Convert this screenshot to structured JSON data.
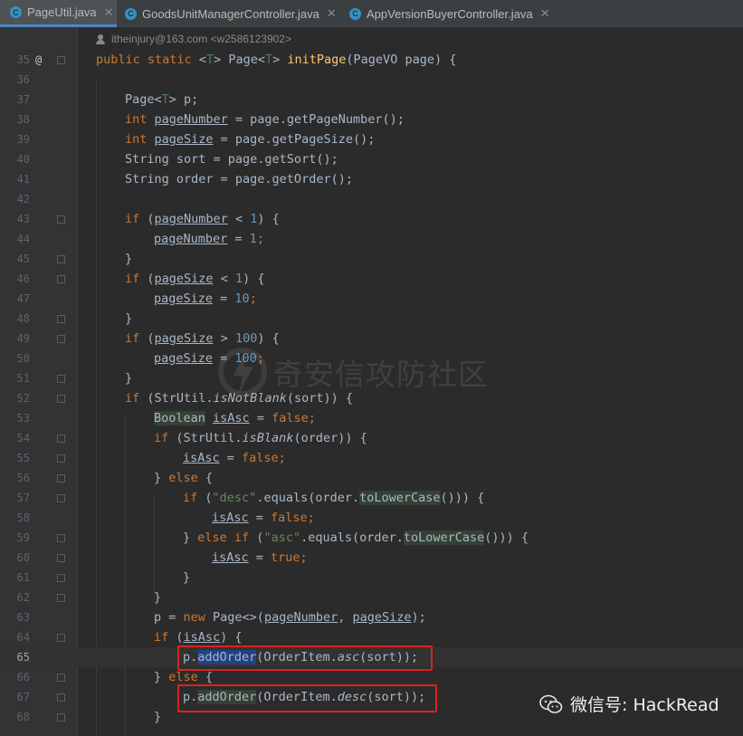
{
  "tabs": [
    {
      "label": "PageUtil.java",
      "active": true
    },
    {
      "label": "GoodsUnitManagerController.java",
      "active": false
    },
    {
      "label": "AppVersionBuyerController.java",
      "active": false
    }
  ],
  "author_hint": "itheinjury@163.com <w2586123902>",
  "line_numbers": [
    "35",
    "36",
    "37",
    "38",
    "39",
    "40",
    "41",
    "42",
    "43",
    "44",
    "45",
    "46",
    "47",
    "48",
    "49",
    "50",
    "51",
    "52",
    "53",
    "54",
    "55",
    "56",
    "57",
    "58",
    "59",
    "60",
    "61",
    "62",
    "63",
    "64",
    "65",
    "66",
    "67",
    "68"
  ],
  "code_lines": [
    [
      {
        "t": "public static ",
        "c": "kw"
      },
      {
        "t": "<"
      },
      {
        "t": "T",
        "c": "tp"
      },
      {
        "t": "> Page<"
      },
      {
        "t": "T",
        "c": "tp"
      },
      {
        "t": "> "
      },
      {
        "t": "initPage",
        "c": "fn"
      },
      {
        "t": "(PageVO page) {"
      }
    ],
    [],
    [
      {
        "t": "Page<"
      },
      {
        "t": "T",
        "c": "tp"
      },
      {
        "t": "> p;"
      }
    ],
    [
      {
        "t": "int ",
        "c": "kw"
      },
      {
        "t": "pageNumber",
        "c": "ul"
      },
      {
        "t": " = page.getPageNumber();"
      }
    ],
    [
      {
        "t": "int ",
        "c": "kw"
      },
      {
        "t": "pageSize",
        "c": "ul"
      },
      {
        "t": " = page.getPageSize();"
      }
    ],
    [
      {
        "t": "String sort = page.getSort();"
      }
    ],
    [
      {
        "t": "String order = page.getOrder();"
      }
    ],
    [],
    [
      {
        "t": "if ",
        "c": "kw"
      },
      {
        "t": "("
      },
      {
        "t": "pageNumber",
        "c": "ul"
      },
      {
        "t": " < "
      },
      {
        "t": "1",
        "c": "nm"
      },
      {
        "t": ") {"
      }
    ],
    [
      {
        "t": "pageNumber",
        "c": "ul"
      },
      {
        "t": " = "
      },
      {
        "t": "1",
        "c": "nm"
      },
      {
        "t": ";",
        "c": "kw"
      }
    ],
    [
      {
        "t": "}"
      }
    ],
    [
      {
        "t": "if ",
        "c": "kw"
      },
      {
        "t": "("
      },
      {
        "t": "pageSize",
        "c": "ul"
      },
      {
        "t": " < "
      },
      {
        "t": "1",
        "c": "nm"
      },
      {
        "t": ") {"
      }
    ],
    [
      {
        "t": "pageSize",
        "c": "ul"
      },
      {
        "t": " = "
      },
      {
        "t": "10",
        "c": "nm"
      },
      {
        "t": ";",
        "c": "kw"
      }
    ],
    [
      {
        "t": "}"
      }
    ],
    [
      {
        "t": "if ",
        "c": "kw"
      },
      {
        "t": "("
      },
      {
        "t": "pageSize",
        "c": "ul"
      },
      {
        "t": " > "
      },
      {
        "t": "100",
        "c": "nm"
      },
      {
        "t": ") {"
      }
    ],
    [
      {
        "t": "pageSize",
        "c": "ul"
      },
      {
        "t": " = "
      },
      {
        "t": "100",
        "c": "nm"
      },
      {
        "t": ";",
        "c": "kw"
      }
    ],
    [
      {
        "t": "}"
      }
    ],
    [
      {
        "t": "if ",
        "c": "kw"
      },
      {
        "t": "(StrUtil."
      },
      {
        "t": "isNotBlank",
        "c": "it"
      },
      {
        "t": "(sort)) {"
      }
    ],
    [
      {
        "t": "Boolean",
        "c": "hl"
      },
      {
        "t": " "
      },
      {
        "t": "isAsc",
        "c": "ul"
      },
      {
        "t": " = "
      },
      {
        "t": "false",
        "c": "kw"
      },
      {
        "t": ";",
        "c": "kw"
      }
    ],
    [
      {
        "t": "if ",
        "c": "kw"
      },
      {
        "t": "(StrUtil."
      },
      {
        "t": "isBlank",
        "c": "it"
      },
      {
        "t": "(order)) {"
      }
    ],
    [
      {
        "t": "isAsc",
        "c": "ul"
      },
      {
        "t": " = "
      },
      {
        "t": "false",
        "c": "kw"
      },
      {
        "t": ";",
        "c": "kw"
      }
    ],
    [
      {
        "t": "} "
      },
      {
        "t": "else ",
        "c": "kw"
      },
      {
        "t": "{"
      }
    ],
    [
      {
        "t": "if ",
        "c": "kw"
      },
      {
        "t": "("
      },
      {
        "t": "\"desc\"",
        "c": "st"
      },
      {
        "t": ".equals(order."
      },
      {
        "t": "toLowerCase",
        "c": "hl"
      },
      {
        "t": "())) {"
      }
    ],
    [
      {
        "t": "isAsc",
        "c": "ul"
      },
      {
        "t": " = "
      },
      {
        "t": "false",
        "c": "kw"
      },
      {
        "t": ";",
        "c": "kw"
      }
    ],
    [
      {
        "t": "} "
      },
      {
        "t": "else if ",
        "c": "kw"
      },
      {
        "t": "("
      },
      {
        "t": "\"asc\"",
        "c": "st"
      },
      {
        "t": ".equals(order."
      },
      {
        "t": "toLowerCase",
        "c": "hl"
      },
      {
        "t": "())) {"
      }
    ],
    [
      {
        "t": "isAsc",
        "c": "ul"
      },
      {
        "t": " = "
      },
      {
        "t": "true",
        "c": "kw"
      },
      {
        "t": ";",
        "c": "kw"
      }
    ],
    [
      {
        "t": "}"
      }
    ],
    [
      {
        "t": "}"
      }
    ],
    [
      {
        "t": "p = "
      },
      {
        "t": "new ",
        "c": "kw"
      },
      {
        "t": "Page<>("
      },
      {
        "t": "pageNumber",
        "c": "ul"
      },
      {
        "t": ", "
      },
      {
        "t": "pageSize",
        "c": "ul"
      },
      {
        "t": ");"
      }
    ],
    [
      {
        "t": "if ",
        "c": "kw"
      },
      {
        "t": "("
      },
      {
        "t": "isAsc",
        "c": "ul"
      },
      {
        "t": ") {"
      }
    ],
    [
      {
        "t": "p."
      },
      {
        "t": "addOrder",
        "c": "sel"
      },
      {
        "t": "(OrderItem."
      },
      {
        "t": "asc",
        "c": "it"
      },
      {
        "t": "(sort));"
      }
    ],
    [
      {
        "t": "} "
      },
      {
        "t": "else ",
        "c": "kw"
      },
      {
        "t": "{"
      }
    ],
    [
      {
        "t": "p."
      },
      {
        "t": "addOrder",
        "c": "hl"
      },
      {
        "t": "(OrderItem."
      },
      {
        "t": "desc",
        "c": "it"
      },
      {
        "t": "(sort));"
      }
    ],
    [
      {
        "t": "}"
      }
    ]
  ],
  "code_indents": [
    0,
    0,
    1,
    1,
    1,
    1,
    1,
    0,
    1,
    2,
    1,
    1,
    2,
    1,
    1,
    2,
    1,
    1,
    2,
    2,
    3,
    2,
    3,
    4,
    3,
    4,
    3,
    2,
    2,
    2,
    3,
    2,
    3,
    2
  ],
  "current_line": "65",
  "highlight_boxes": [
    "65",
    "67"
  ],
  "watermark": "奇安信攻防社区",
  "footer_badge": "微信号: HackRead",
  "colors": {
    "keyword": "#cc7832",
    "string": "#6a8759",
    "number": "#6897bb",
    "method": "#ffc66d",
    "text": "#a9b7c6",
    "highlight_box": "#e0201f"
  }
}
